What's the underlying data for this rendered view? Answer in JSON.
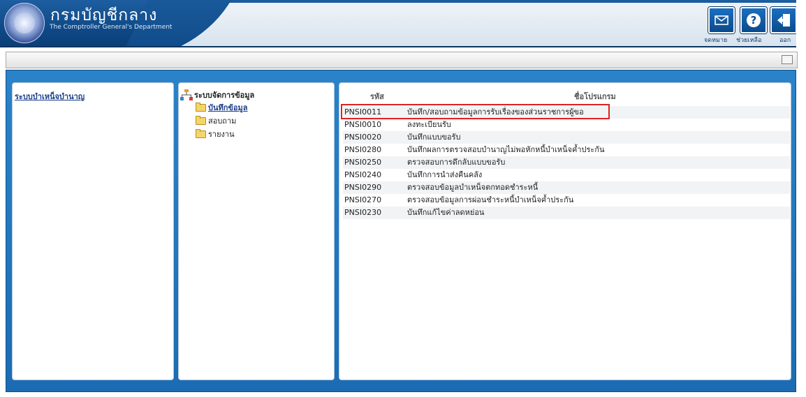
{
  "header": {
    "brand_thai": "กรมบัญชีกลาง",
    "brand_eng": "The Comptroller General's Department",
    "buttons": [
      {
        "icon": "mail-icon",
        "label": "จดหมาย"
      },
      {
        "icon": "help-icon",
        "label": "ช่วยเหลือ"
      },
      {
        "icon": "exit-icon",
        "label": "ออก"
      }
    ]
  },
  "system_link": "ระบบบำเหน็จบำนาญ",
  "tree": {
    "root": "ระบบจัดการข้อมูล",
    "items": [
      {
        "label": "บันทึกข้อมูล",
        "active": true
      },
      {
        "label": "สอบถาม",
        "active": false
      },
      {
        "label": "รายงาน",
        "active": false
      }
    ]
  },
  "table": {
    "headers": {
      "code": "รหัส",
      "name": "ชื่อโปรแกรม"
    },
    "rows": [
      {
        "code": "PNSI0011",
        "name": "บันทึก/สอบถามข้อมูลการรับเรื่องของส่วนราชการผู้ขอ"
      },
      {
        "code": "PNSI0010",
        "name": "ลงทะเบียนรับ"
      },
      {
        "code": "PNSI0020",
        "name": "บันทึกแบบขอรับ"
      },
      {
        "code": "PNSI0280",
        "name": "บันทึกผลการตรวจสอบบำนาญไม่พอหักหนี้บำเหน็จค้ำประกัน"
      },
      {
        "code": "PNSI0250",
        "name": "ตรวจสอบการดึกลับแบบขอรับ"
      },
      {
        "code": "PNSI0240",
        "name": "บันทึกการนำส่งคืนคลัง"
      },
      {
        "code": "PNSI0290",
        "name": "ตรวจสอบข้อมูลบำเหน็จตกทอดชำระหนี้"
      },
      {
        "code": "PNSI0270",
        "name": "ตรวจสอบข้อมูลการผ่อนชำระหนี้บำเหน็จค้ำประกัน"
      },
      {
        "code": "PNSI0230",
        "name": "บันทึกแก้ไขค่าลดหย่อน"
      }
    ]
  },
  "colors": {
    "accent": "#1b6cb3",
    "highlight": "#e02020",
    "link": "#1a3e8a"
  }
}
